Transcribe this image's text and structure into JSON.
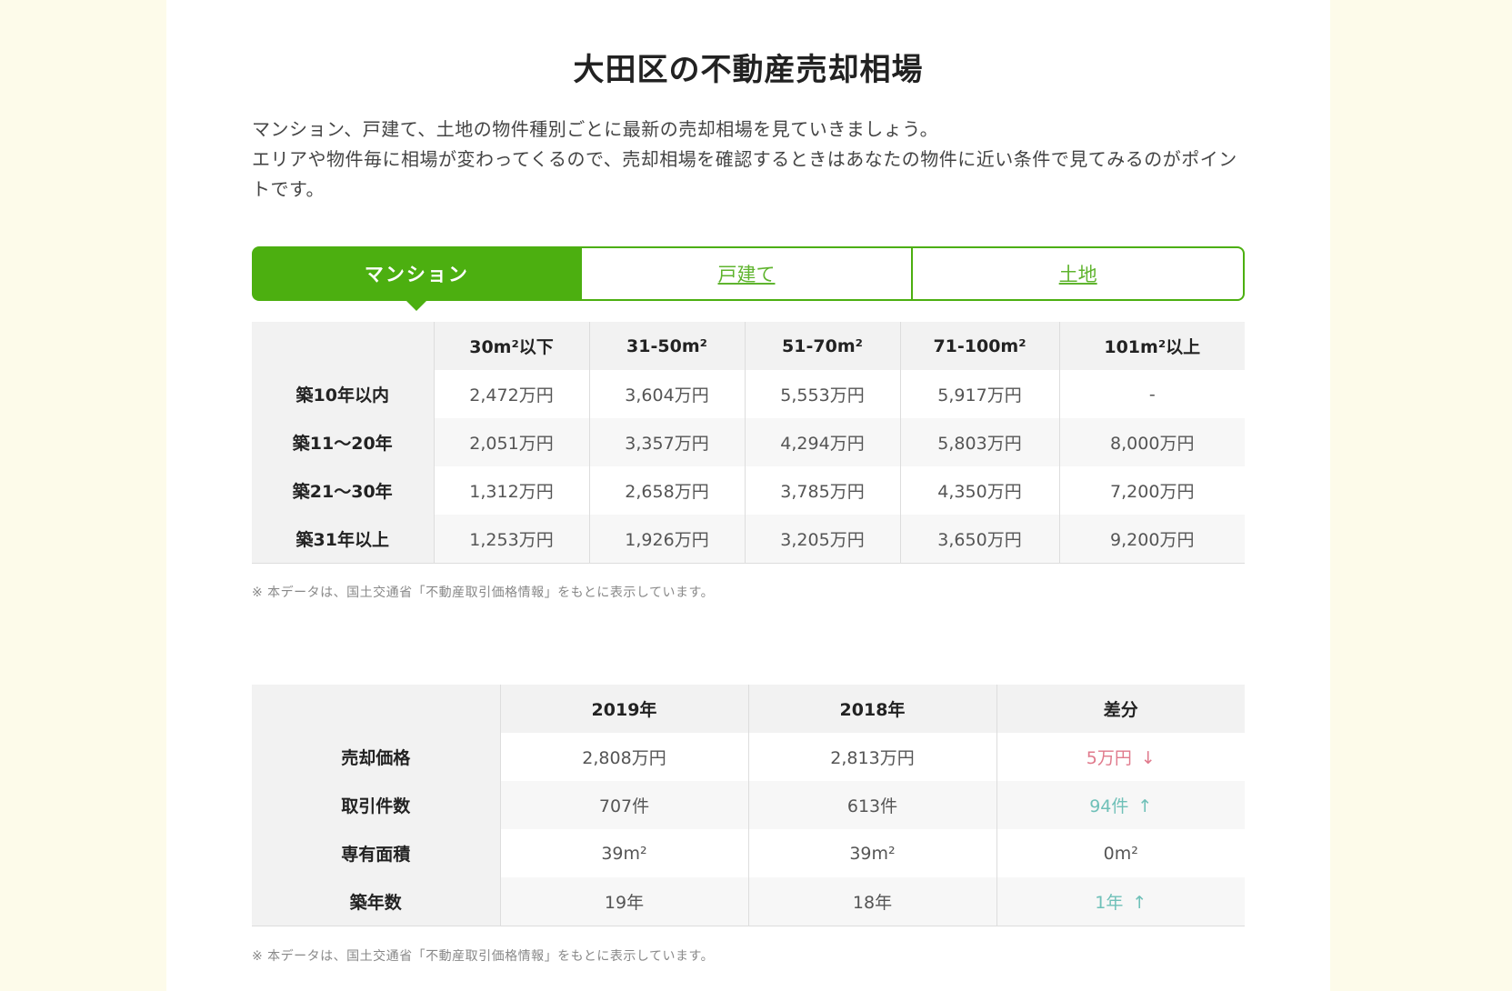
{
  "page": {
    "title": "大田区の不動産売却相場",
    "intro_line1": "マンション、戸建て、土地の物件種別ごとに最新の売却相場を見ていきましょう。",
    "intro_line2": "エリアや物件毎に相場が変わってくるので、売却相場を確認するときはあなたの物件に近い条件で見てみるのがポイントです。"
  },
  "tabs": [
    {
      "label": "マンション",
      "active": true
    },
    {
      "label": "戸建て",
      "active": false
    },
    {
      "label": "土地",
      "active": false
    }
  ],
  "price_table": {
    "corner": "",
    "headers": [
      "30m²以下",
      "31-50m²",
      "51-70m²",
      "71-100m²",
      "101m²以上"
    ],
    "rows": [
      {
        "label": "築10年以内",
        "cells": [
          "2,472万円",
          "3,604万円",
          "5,553万円",
          "5,917万円",
          "-"
        ]
      },
      {
        "label": "築11〜20年",
        "cells": [
          "2,051万円",
          "3,357万円",
          "4,294万円",
          "5,803万円",
          "8,000万円"
        ]
      },
      {
        "label": "築21〜30年",
        "cells": [
          "1,312万円",
          "2,658万円",
          "3,785万円",
          "4,350万円",
          "7,200万円"
        ]
      },
      {
        "label": "築31年以上",
        "cells": [
          "1,253万円",
          "1,926万円",
          "3,205万円",
          "3,650万円",
          "9,200万円"
        ]
      }
    ]
  },
  "compare_table": {
    "corner": "",
    "headers": [
      "2019年",
      "2018年",
      "差分"
    ],
    "rows": [
      {
        "label": "売却価格",
        "y2019": "2,808万円",
        "y2018": "2,813万円",
        "diff": "5万円",
        "arrow": "↓",
        "trend": "down"
      },
      {
        "label": "取引件数",
        "y2019": "707件",
        "y2018": "613件",
        "diff": "94件",
        "arrow": "↑",
        "trend": "up"
      },
      {
        "label": "専有面積",
        "y2019": "39m²",
        "y2018": "39m²",
        "diff": "0m²",
        "arrow": "",
        "trend": "neutral"
      },
      {
        "label": "築年数",
        "y2019": "19年",
        "y2018": "18年",
        "diff": "1年",
        "arrow": "↑",
        "trend": "up"
      }
    ]
  },
  "notes": {
    "source_note": "※ 本データは、国土交通省「不動産取引価格情報」をもとに表示しています。"
  },
  "colors": {
    "accent_green": "#4caf10",
    "page_background": "#fdfbea",
    "diff_down": "#e07a8c",
    "diff_up": "#6fc0b8"
  }
}
